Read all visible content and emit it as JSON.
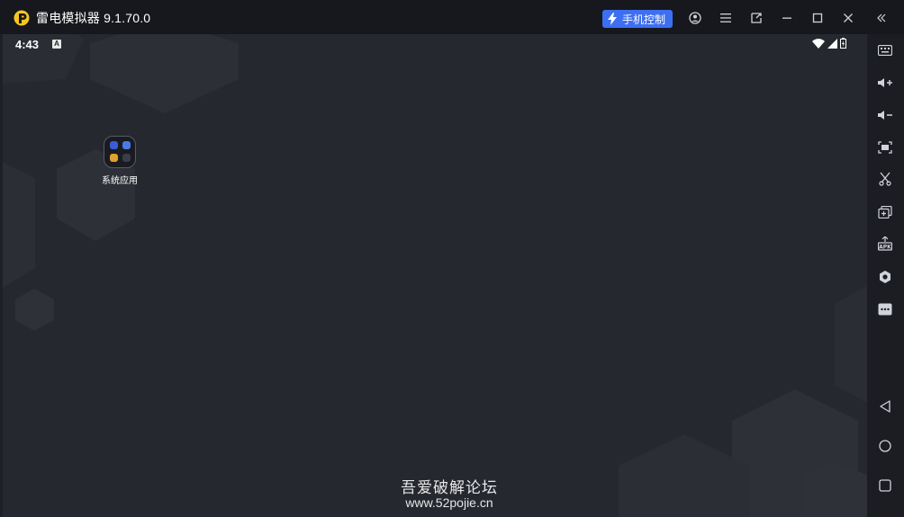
{
  "window": {
    "title": "雷电模拟器 9.1.70.0",
    "phone_control_label": "手机控制",
    "icons": [
      "logo-icon",
      "lightning-icon",
      "account-icon",
      "menu-icon",
      "popout-icon",
      "minimize-icon",
      "maximize-icon",
      "close-icon",
      "collapse-sidebar-icon"
    ]
  },
  "status_bar": {
    "time": "4:43",
    "notification": "A",
    "icons": [
      "wifi-icon",
      "signal-icon",
      "battery-icon"
    ]
  },
  "desktop": {
    "folder_label": "系统应用"
  },
  "watermark": {
    "line1": "吾爱破解论坛",
    "line2": "www.52pojie.cn"
  },
  "sidebar": {
    "icons": [
      "keyboard-icon",
      "volume-up-icon",
      "volume-down-icon",
      "screenshot-icon",
      "scissors-icon",
      "multi-instance-icon",
      "apk-install-icon",
      "settings-icon",
      "more-icon",
      "back-icon",
      "home-icon",
      "recents-icon"
    ]
  },
  "colors": {
    "accent": "#3d6ff2",
    "titlebar": "#17181d",
    "screen": "#262830",
    "sidebar": "#1c1d22"
  }
}
